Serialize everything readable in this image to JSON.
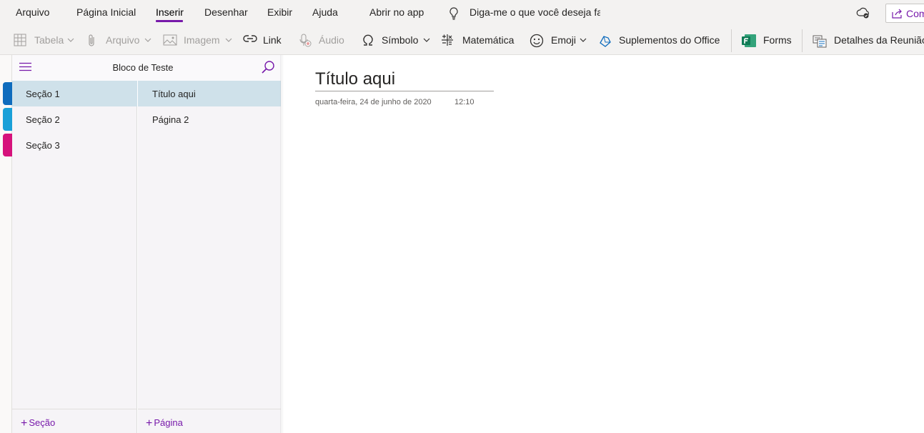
{
  "menu": {
    "tabs": [
      "Arquivo",
      "Página Inicial",
      "Inserir",
      "Desenhar",
      "Exibir",
      "Ajuda"
    ],
    "active_tab": "Inserir",
    "open_in_app": "Abrir no app",
    "tell_me": "Diga-me o que você deseja fazer",
    "share_label": "Compartilhar"
  },
  "toolbar": {
    "table": "Tabela",
    "file": "Arquivo",
    "image": "Imagem",
    "link": "Link",
    "audio": "Áudio",
    "symbol": "Símbolo",
    "math": "Matemática",
    "emoji": "Emoji",
    "office_addins": "Suplementos do Office",
    "forms": "Forms",
    "meeting_details": "Detalhes da Reunião"
  },
  "notebook": {
    "title": "Bloco de Teste",
    "section_colors": [
      "#0f6cbd",
      "#1aa0d8",
      "#d6127c"
    ],
    "sections": [
      "Seção 1",
      "Seção 2",
      "Seção 3"
    ],
    "selected_section": "Seção 1",
    "add_section": "Seção",
    "pages": [
      "Título aqui",
      "Página 2"
    ],
    "selected_page": "Título aqui",
    "add_page": "Página"
  },
  "page": {
    "title": "Título aqui",
    "date": "quarta-feira, 24 de junho de 2020",
    "time": "12:10"
  },
  "colors": {
    "accent": "#7719aa",
    "selection": "#cfe1ea"
  }
}
